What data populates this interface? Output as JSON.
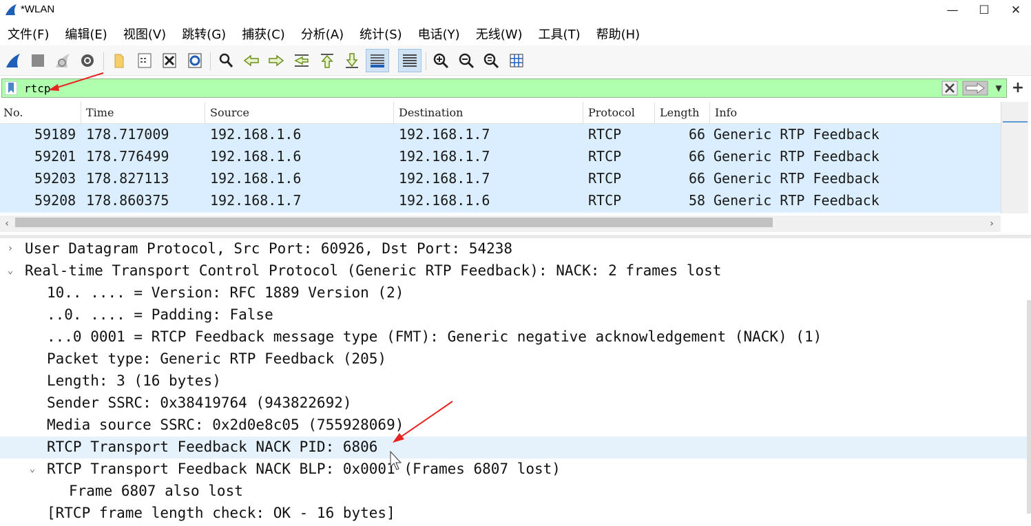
{
  "window": {
    "title": "*WLAN",
    "controls": {
      "minimize": "—",
      "maximize": "☐",
      "close": "✕"
    }
  },
  "menu": [
    "文件(F)",
    "编辑(E)",
    "视图(V)",
    "跳转(G)",
    "捕获(C)",
    "分析(A)",
    "统计(S)",
    "电话(Y)",
    "无线(W)",
    "工具(T)",
    "帮助(H)"
  ],
  "toolbar": {
    "icons": [
      "start-capture-icon",
      "stop-capture-icon",
      "restart-capture-icon",
      "capture-options-icon",
      "open-file-icon",
      "save-file-icon",
      "close-file-icon",
      "reload-file-icon",
      "find-packet-icon",
      "go-back-icon",
      "go-forward-icon",
      "go-to-packet-icon",
      "go-first-icon",
      "go-last-icon",
      "autoscroll-icon",
      "colorize-icon",
      "zoom-in-icon",
      "zoom-out-icon",
      "zoom-normal-icon",
      "resize-columns-icon"
    ],
    "active": [
      "autoscroll-icon",
      "colorize-icon"
    ]
  },
  "filter": {
    "value": "rtcp",
    "background": "#afffaf"
  },
  "packet_list": {
    "columns": [
      "No.",
      "Time",
      "Source",
      "Destination",
      "Protocol",
      "Length",
      "Info"
    ],
    "rows": [
      {
        "no": "59189",
        "time": "178.717009",
        "source": "192.168.1.6",
        "destination": "192.168.1.7",
        "protocol": "RTCP",
        "length": "66",
        "info": "Generic RTP Feedback"
      },
      {
        "no": "59201",
        "time": "178.776499",
        "source": "192.168.1.6",
        "destination": "192.168.1.7",
        "protocol": "RTCP",
        "length": "66",
        "info": "Generic RTP Feedback"
      },
      {
        "no": "59203",
        "time": "178.827113",
        "source": "192.168.1.6",
        "destination": "192.168.1.7",
        "protocol": "RTCP",
        "length": "66",
        "info": "Generic RTP Feedback"
      },
      {
        "no": "59208",
        "time": "178.860375",
        "source": "192.168.1.7",
        "destination": "192.168.1.6",
        "protocol": "RTCP",
        "length": "58",
        "info": "Generic RTP Feedback"
      }
    ],
    "row_color": "#daeeff"
  },
  "details": {
    "lines": [
      {
        "text": "User Datagram Protocol, Src Port: 60926, Dst Port: 54238",
        "arrow": "›",
        "expanded": false
      },
      {
        "text": "Real-time Transport Control Protocol (Generic RTP Feedback): NACK: 2 frames lost",
        "arrow": "⌄",
        "expanded": true
      },
      {
        "text": "10.. .... = Version: RFC 1889 Version (2)"
      },
      {
        "text": "..0. .... = Padding: False"
      },
      {
        "text": "...0 0001 = RTCP Feedback message type (FMT): Generic negative acknowledgement (NACK) (1)"
      },
      {
        "text": "Packet type: Generic RTP Feedback (205)"
      },
      {
        "text": "Length: 3 (16 bytes)"
      },
      {
        "text": "Sender SSRC: 0x38419764 (943822692)"
      },
      {
        "text": "Media source SSRC: 0x2d0e8c05 (755928069)"
      },
      {
        "text": "RTCP Transport Feedback NACK PID: 6806",
        "selected": true
      },
      {
        "text": "RTCP Transport Feedback NACK BLP: 0x0001 (Frames 6807 lost)",
        "arrow": "⌄",
        "expanded": true
      },
      {
        "text": "Frame 6807 also lost"
      },
      {
        "text": "[RTCP frame length check: OK - 16 bytes]"
      }
    ]
  },
  "colors": {
    "selected_detail": "#e5f1fb",
    "annotation": "#e8231f"
  }
}
